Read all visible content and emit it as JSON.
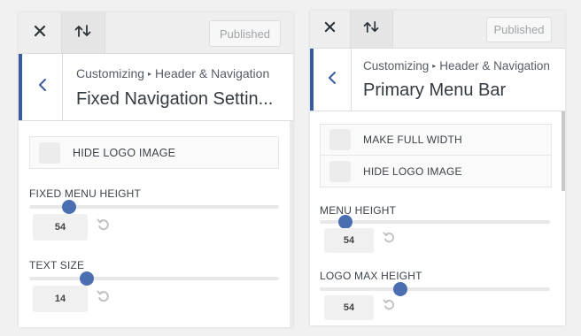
{
  "colors": {
    "accent": "#3a5aa0",
    "slider_knob": "#4a6fb1"
  },
  "icons": {
    "close": "close-icon",
    "sort": "sort-arrows-icon",
    "back": "chevron-left-icon",
    "reset": "undo-icon"
  },
  "panel_left": {
    "published_label": "Published",
    "breadcrumb": [
      "Customizing",
      "Header & Navigation"
    ],
    "title": "Fixed Navigation Settin...",
    "hide_logo_label": "HIDE LOGO IMAGE",
    "fixed_menu_height": {
      "label": "FIXED MENU HEIGHT",
      "value": "54",
      "slider_fraction": 0.16
    },
    "text_size": {
      "label": "TEXT SIZE",
      "value": "14",
      "slider_fraction": 0.23
    }
  },
  "panel_right": {
    "published_label": "Published",
    "breadcrumb": [
      "Customizing",
      "Header & Navigation"
    ],
    "title": "Primary Menu Bar",
    "make_full_width_label": "MAKE FULL WIDTH",
    "hide_logo_label": "HIDE LOGO IMAGE",
    "menu_height": {
      "label": "MENU HEIGHT",
      "value": "54",
      "slider_fraction": 0.11
    },
    "logo_max_height": {
      "label": "LOGO MAX HEIGHT",
      "value": "54",
      "slider_fraction": 0.35
    }
  }
}
